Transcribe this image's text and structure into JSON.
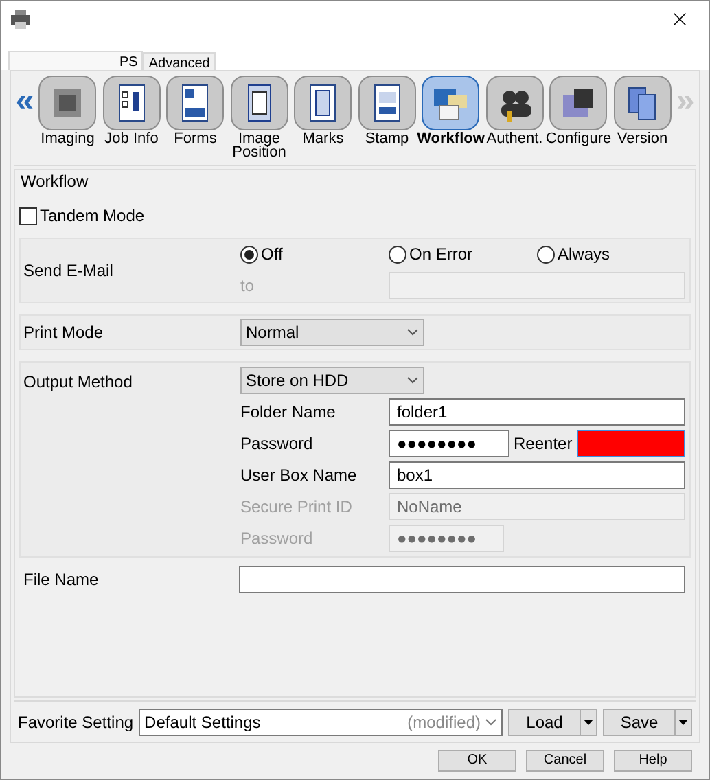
{
  "tabs": [
    {
      "label": "PS",
      "selected": true
    },
    {
      "label": "Advanced",
      "selected": false
    }
  ],
  "nav": {
    "prev": {
      "label": "«",
      "disabled": false
    },
    "next": {
      "label": "»",
      "disabled": true
    }
  },
  "categories": [
    {
      "label": "Imaging",
      "kind": "imaging",
      "selected": false
    },
    {
      "label": "Job Info",
      "kind": "jobinfo",
      "selected": false
    },
    {
      "label": "Forms",
      "kind": "forms",
      "selected": false
    },
    {
      "label": "Image Position",
      "kind": "position",
      "selected": false
    },
    {
      "label": "Marks",
      "kind": "marks",
      "selected": false
    },
    {
      "label": "Stamp",
      "kind": "stamp",
      "selected": false
    },
    {
      "label": "Workflow",
      "kind": "workflow",
      "selected": true
    },
    {
      "label": "Authent.",
      "kind": "auth",
      "selected": false
    },
    {
      "label": "Configure",
      "kind": "configure",
      "selected": false
    },
    {
      "label": "Version",
      "kind": "version",
      "selected": false
    }
  ],
  "workflow": {
    "legend": "Workflow",
    "tandem": {
      "label": "Tandem Mode",
      "checked": false
    },
    "send_email": {
      "label": "Send E-Mail",
      "options": [
        {
          "label": "Off",
          "selected": true
        },
        {
          "label": "On Error",
          "selected": false
        },
        {
          "label": "Always",
          "selected": false
        }
      ],
      "to_label": "to",
      "to_disabled": true
    },
    "print_mode": {
      "label": "Print Mode",
      "value": "Normal"
    },
    "output_method": {
      "label": "Output Method",
      "value": "Store on HDD",
      "fields": [
        {
          "kind": "text",
          "label": "Folder Name",
          "value": "folder1",
          "disabled": false
        },
        {
          "kind": "password_pair",
          "label": "Password",
          "value": "●●●●●●●●",
          "reenter_label": "Reenter",
          "reenter_error": true,
          "disabled": false
        },
        {
          "kind": "text",
          "label": "User Box Name",
          "value": "box1",
          "disabled": false
        },
        {
          "kind": "text",
          "label": "Secure Print ID",
          "value": "NoName",
          "disabled": true
        },
        {
          "kind": "short",
          "label": "Password",
          "value": "●●●●●●●●",
          "disabled": true
        }
      ]
    },
    "file_name": {
      "label": "File Name"
    }
  },
  "favorite": {
    "label": "Favorite Setting",
    "value": "Default Settings",
    "note": "(modified)",
    "buttons": [
      "Load",
      "Save"
    ]
  },
  "buttons": [
    "OK",
    "Cancel",
    "Help"
  ]
}
